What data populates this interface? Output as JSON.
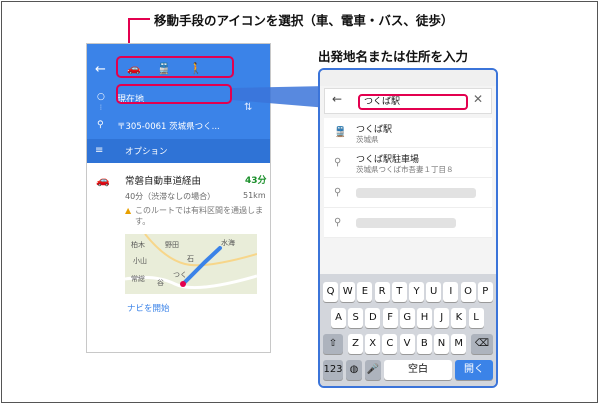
{
  "callouts": {
    "transport": "移動手段のアイコンを選択（車、電車・バス、徒歩）",
    "departure": "出発地名または住所を入力"
  },
  "left": {
    "back_icon": "arrow-back-icon",
    "modes": [
      "car-icon",
      "train-icon",
      "walk-icon"
    ],
    "from": "現在地",
    "to": "〒305-0061 茨城県つく...",
    "options_label": "オプション",
    "route": {
      "title": "常磐自動車道経由",
      "time": "43分",
      "detail": "40分（渋滞なしの場合）",
      "distance": "51km",
      "warning": "このルートでは有料区間を通過します。"
    },
    "map_labels": [
      "柏木",
      "小山",
      "水海",
      "つく",
      "石",
      "野田",
      "谷",
      "常総"
    ],
    "navi": "ナビを開始"
  },
  "right": {
    "search_value": "つくば駅",
    "results": [
      {
        "icon": "train-icon",
        "main": "つくば駅",
        "sub": "茨城県"
      },
      {
        "icon": "pin-icon",
        "main": "つくば駅駐車場",
        "sub": "茨城県つくば市吾妻１丁目８"
      },
      {
        "icon": "pin-icon"
      },
      {
        "icon": "pin-icon"
      }
    ],
    "keyboard": {
      "row1": [
        "Q",
        "W",
        "E",
        "R",
        "T",
        "Y",
        "U",
        "I",
        "O",
        "P"
      ],
      "row2": [
        "A",
        "S",
        "D",
        "F",
        "G",
        "H",
        "J",
        "K",
        "L"
      ],
      "row3": [
        "Z",
        "X",
        "C",
        "V",
        "B",
        "N",
        "M"
      ],
      "num": "123",
      "space": "空白",
      "go": "開く"
    }
  },
  "colors": {
    "accent": "#e3004f",
    "blue": "#3b83e8"
  }
}
